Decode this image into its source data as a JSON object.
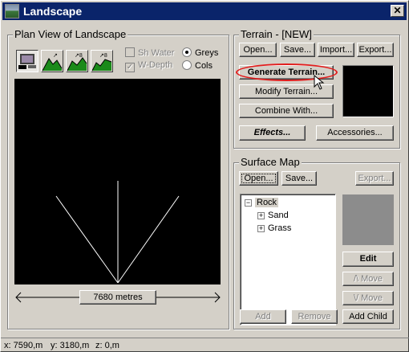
{
  "window": {
    "title": "Landscape",
    "close_glyph": "✕"
  },
  "plan_view": {
    "group_title": "Plan View of Landscape",
    "checkboxes": [
      {
        "label": "Sh Water",
        "checked": false,
        "enabled": false
      },
      {
        "label": "W-Depth",
        "checked": true,
        "enabled": false
      }
    ],
    "radios": [
      {
        "label": "Greys",
        "selected": true
      },
      {
        "label": "Cols",
        "selected": false
      }
    ],
    "scale_label": "7680 metres"
  },
  "terrain": {
    "group_title": "Terrain - [NEW]",
    "buttons": {
      "open": "Open...",
      "save": "Save...",
      "import": "Import...",
      "export": "Export...",
      "generate": "Generate Terrain...",
      "modify": "Modify Terrain...",
      "combine": "Combine With...",
      "effects": "Effects...",
      "accessories": "Accessories..."
    }
  },
  "surface_map": {
    "group_title": "Surface Map",
    "buttons": {
      "open": "Open...",
      "save": "Save...",
      "export": "Export...",
      "edit": "Edit",
      "move_up": "/\\ Move",
      "move_down": "\\/ Move",
      "add": "Add",
      "remove": "Remove",
      "add_child": "Add Child"
    },
    "tree": {
      "root": "Rock",
      "root_toggle": "−",
      "children": [
        {
          "label": "Sand",
          "toggle": "+"
        },
        {
          "label": "Grass",
          "toggle": "+"
        }
      ]
    }
  },
  "status": {
    "x": "x: 7590,m",
    "y": "y: 3180,m",
    "z": "z: 0,m"
  },
  "colors": {
    "titlebar": "#0a246a",
    "highlight": "#e21d1d",
    "canvas": "#000000",
    "surface_preview": "#8c8c8c"
  }
}
